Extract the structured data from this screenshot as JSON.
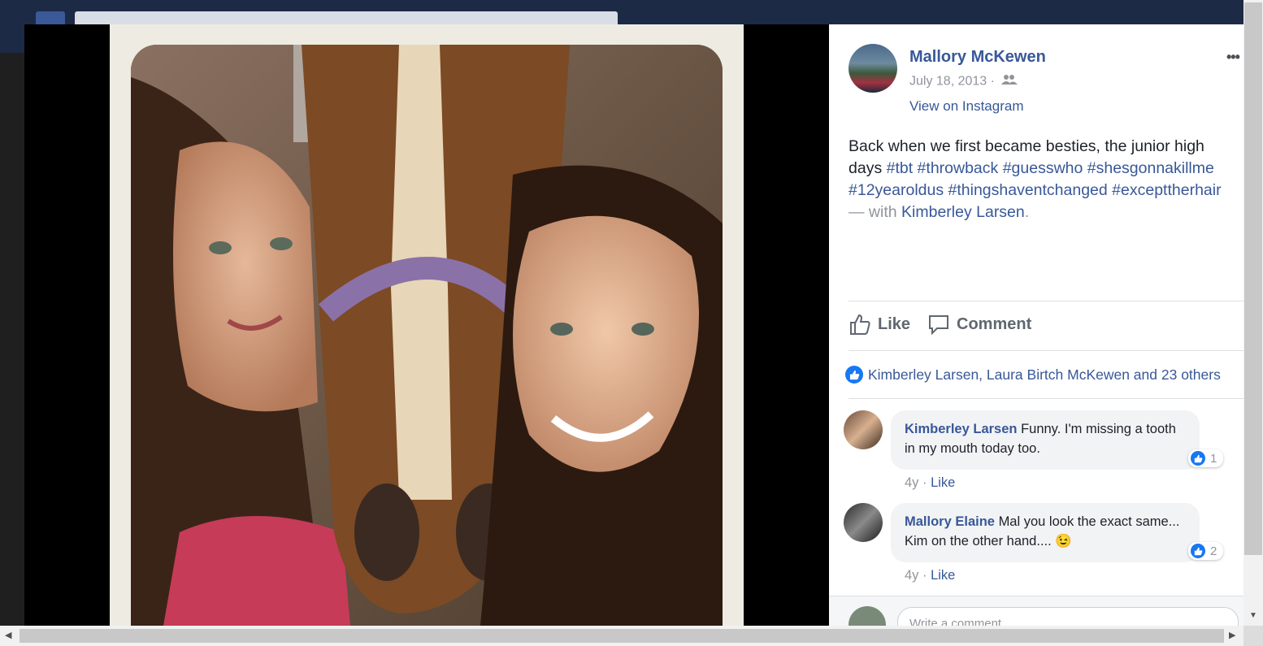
{
  "post": {
    "author": "Mallory McKewen",
    "date": "July 18, 2013 · ",
    "instagram_link": "View on Instagram",
    "more": "•••",
    "caption": {
      "line1": "Back when we first became besties, the junior high",
      "line2_text": "days ",
      "line2_tags": "#tbt #throwback #guesswho #shesgonnakillme",
      "line3_tags": "#12yearoldus #thingshaventchanged #excepttherhair",
      "with": "— with ",
      "tagged": "Kimberley Larsen",
      "period": "."
    }
  },
  "actions": {
    "like": "Like",
    "comment": "Comment"
  },
  "reactions": {
    "summary": "Kimberley Larsen, Laura Birtch McKewen and 23 others"
  },
  "comments": [
    {
      "author": "Kimberley Larsen",
      "text": "Funny. I'm missing a tooth in my mouth today too.",
      "likes": "1",
      "age": "4y · ",
      "like_label": "Like"
    },
    {
      "author": "Mallory Elaine",
      "text": "Mal you look the exact same... Kim on the other hand.... 😉",
      "likes": "2",
      "age": "4y · ",
      "like_label": "Like"
    }
  ],
  "composer": {
    "placeholder": "Write a comment..."
  },
  "colors": {
    "link": "#385898",
    "like_blue": "#1877f2",
    "muted": "#90949c"
  },
  "icons": [
    "more-icon",
    "friends-icon",
    "like-thumb-icon",
    "comment-bubble-icon",
    "like-badge-icon"
  ]
}
